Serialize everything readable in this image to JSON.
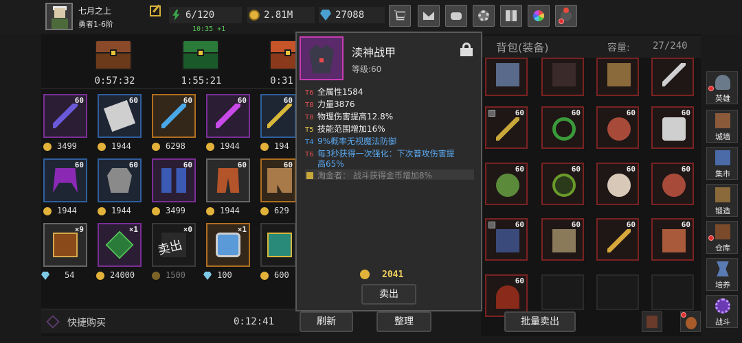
{
  "player": {
    "name": "七月之上",
    "rank": "勇者1-6阶"
  },
  "resources": {
    "stamina": "6/120",
    "stamina_regen": "10:35 +1",
    "gold": "2.81M",
    "gems": "27088"
  },
  "top_buttons": [
    "shop-cart-icon",
    "mail-icon",
    "gamepad-icon",
    "settings-gear-icon",
    "gift-icon",
    "color-wheel-icon",
    "fireworks-icon"
  ],
  "shop": {
    "chest_timers": [
      "0:57:32",
      "1:55:21",
      "0:31"
    ],
    "items": [
      {
        "level": "60",
        "price": "3499"
      },
      {
        "level": "60",
        "price": "1944"
      },
      {
        "level": "60",
        "price": "6298"
      },
      {
        "level": "60",
        "price": "1944"
      },
      {
        "level": "60",
        "price": "194"
      },
      {
        "level": "60",
        "price": "1944"
      },
      {
        "level": "60",
        "price": "1944"
      },
      {
        "level": "60",
        "price": "3499"
      },
      {
        "level": "60",
        "price": "1944"
      },
      {
        "level": "60",
        "price": "629"
      },
      {
        "count": "×9",
        "price": "54"
      },
      {
        "count": "×1",
        "price": "24000"
      },
      {
        "count": "×0",
        "price": "1500"
      },
      {
        "count": "×1",
        "price": "100"
      },
      {
        "count": "",
        "price": "600"
      }
    ],
    "sold_stamp": "卖出",
    "quick_buy": "快捷购买",
    "refresh_timer": "0:12:41",
    "refresh_button": "刷新"
  },
  "tooltip": {
    "name": "渎神战甲",
    "level": "等级:60",
    "stats": [
      {
        "tier": "T6",
        "text": "全属性1584"
      },
      {
        "tier": "T8",
        "text": "力量3876"
      },
      {
        "tier": "T8",
        "text": "物理伤害提高12.8%"
      },
      {
        "tier": "T5",
        "text": "技能范围增加16%"
      },
      {
        "tier": "T4",
        "text": "9%概率无视魔法防御"
      },
      {
        "tier": "T6",
        "text": "每3秒获得一次强化：下次普攻伤害提"
      },
      {
        "tier": "",
        "text": "高65%"
      }
    ],
    "passive": "淘金者：  战斗获得金币增加8%",
    "price": "2041",
    "sell_button": "卖出"
  },
  "bag": {
    "title": "背包(装备)",
    "capacity_label": "容量:",
    "capacity_value": "27/240",
    "sort_button": "整理",
    "bulk_sell_button": "批量卖出",
    "slot_level": "60"
  },
  "side_nav": [
    "英雄",
    "城墙",
    "集市",
    "锻造",
    "仓库",
    "培养",
    "战斗"
  ],
  "colors": {
    "tier_red": "#e05050",
    "tier_yellow": "#e8c84a",
    "tier_blue": "#4a9ae8",
    "skill_blue": "#5aa8f0",
    "purple_rarity": "#7a2e96",
    "red_rarity": "#7a2222"
  }
}
